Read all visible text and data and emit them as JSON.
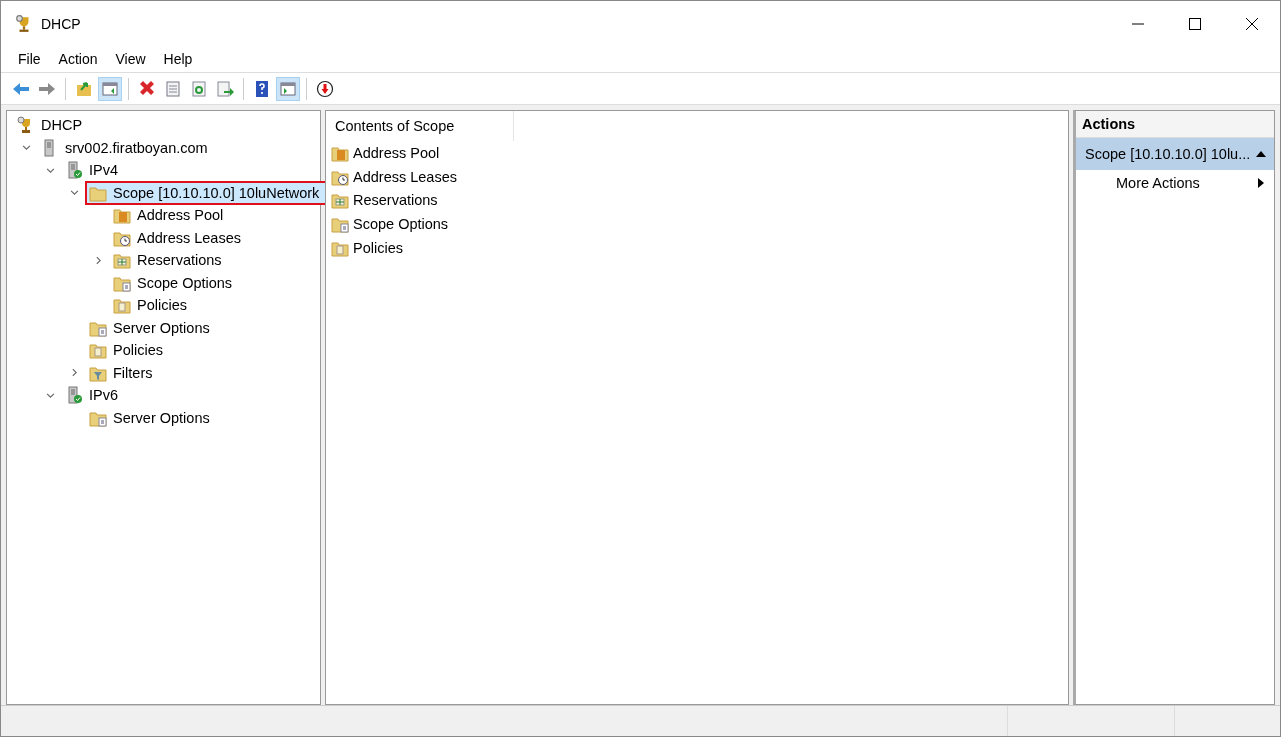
{
  "window": {
    "title": "DHCP"
  },
  "menu": [
    "File",
    "Action",
    "View",
    "Help"
  ],
  "toolbar": [
    [
      {
        "kind": "back",
        "pressed": false
      },
      {
        "kind": "forward",
        "pressed": false
      }
    ],
    [
      {
        "kind": "up",
        "pressed": false
      },
      {
        "kind": "tree-toggle",
        "pressed": true
      }
    ],
    [
      {
        "kind": "delete",
        "pressed": false
      },
      {
        "kind": "properties",
        "pressed": false
      },
      {
        "kind": "refresh",
        "pressed": false
      },
      {
        "kind": "export",
        "pressed": false
      }
    ],
    [
      {
        "kind": "help",
        "pressed": false
      },
      {
        "kind": "action-toggle",
        "pressed": true
      }
    ],
    [
      {
        "kind": "stop",
        "pressed": false
      }
    ]
  ],
  "tree": [
    {
      "label": "DHCP",
      "kind": "root",
      "selected": false,
      "children": [
        {
          "label": "srv002.firatboyan.com",
          "kind": "server",
          "selected": false,
          "expanded": true,
          "children": [
            {
              "label": "IPv4",
              "kind": "protocol",
              "selected": false,
              "expanded": true,
              "children": [
                {
                  "label": "Scope [10.10.10.0] 10luNetwork",
                  "kind": "scope",
                  "selected": true,
                  "expanded": true,
                  "children": [
                    {
                      "label": "Address Pool",
                      "kind": "pool",
                      "selected": false
                    },
                    {
                      "label": "Address Leases",
                      "kind": "leases",
                      "selected": false
                    },
                    {
                      "label": "Reservations",
                      "kind": "reservations",
                      "selected": false,
                      "expanded": false
                    },
                    {
                      "label": "Scope Options",
                      "kind": "options",
                      "selected": false
                    },
                    {
                      "label": "Policies",
                      "kind": "policies",
                      "selected": false
                    }
                  ]
                },
                {
                  "label": "Server Options",
                  "kind": "server-options",
                  "selected": false
                },
                {
                  "label": "Policies",
                  "kind": "policies",
                  "selected": false
                },
                {
                  "label": "Filters",
                  "kind": "filters",
                  "selected": false,
                  "expanded": false
                }
              ]
            },
            {
              "label": "IPv6",
              "kind": "protocol",
              "selected": false,
              "expanded": true,
              "children": [
                {
                  "label": "Server Options",
                  "kind": "server-options",
                  "selected": false
                }
              ]
            }
          ]
        }
      ]
    }
  ],
  "contents": {
    "column": "Contents of Scope",
    "items": [
      {
        "label": "Address Pool",
        "kind": "pool"
      },
      {
        "label": "Address Leases",
        "kind": "leases"
      },
      {
        "label": "Reservations",
        "kind": "reservations"
      },
      {
        "label": "Scope Options",
        "kind": "options"
      },
      {
        "label": "Policies",
        "kind": "policies"
      }
    ]
  },
  "actions": {
    "title": "Actions",
    "section": {
      "label": "Scope [10.10.10.0] 10lu...",
      "expanded": true
    },
    "items": [
      "More Actions"
    ]
  }
}
